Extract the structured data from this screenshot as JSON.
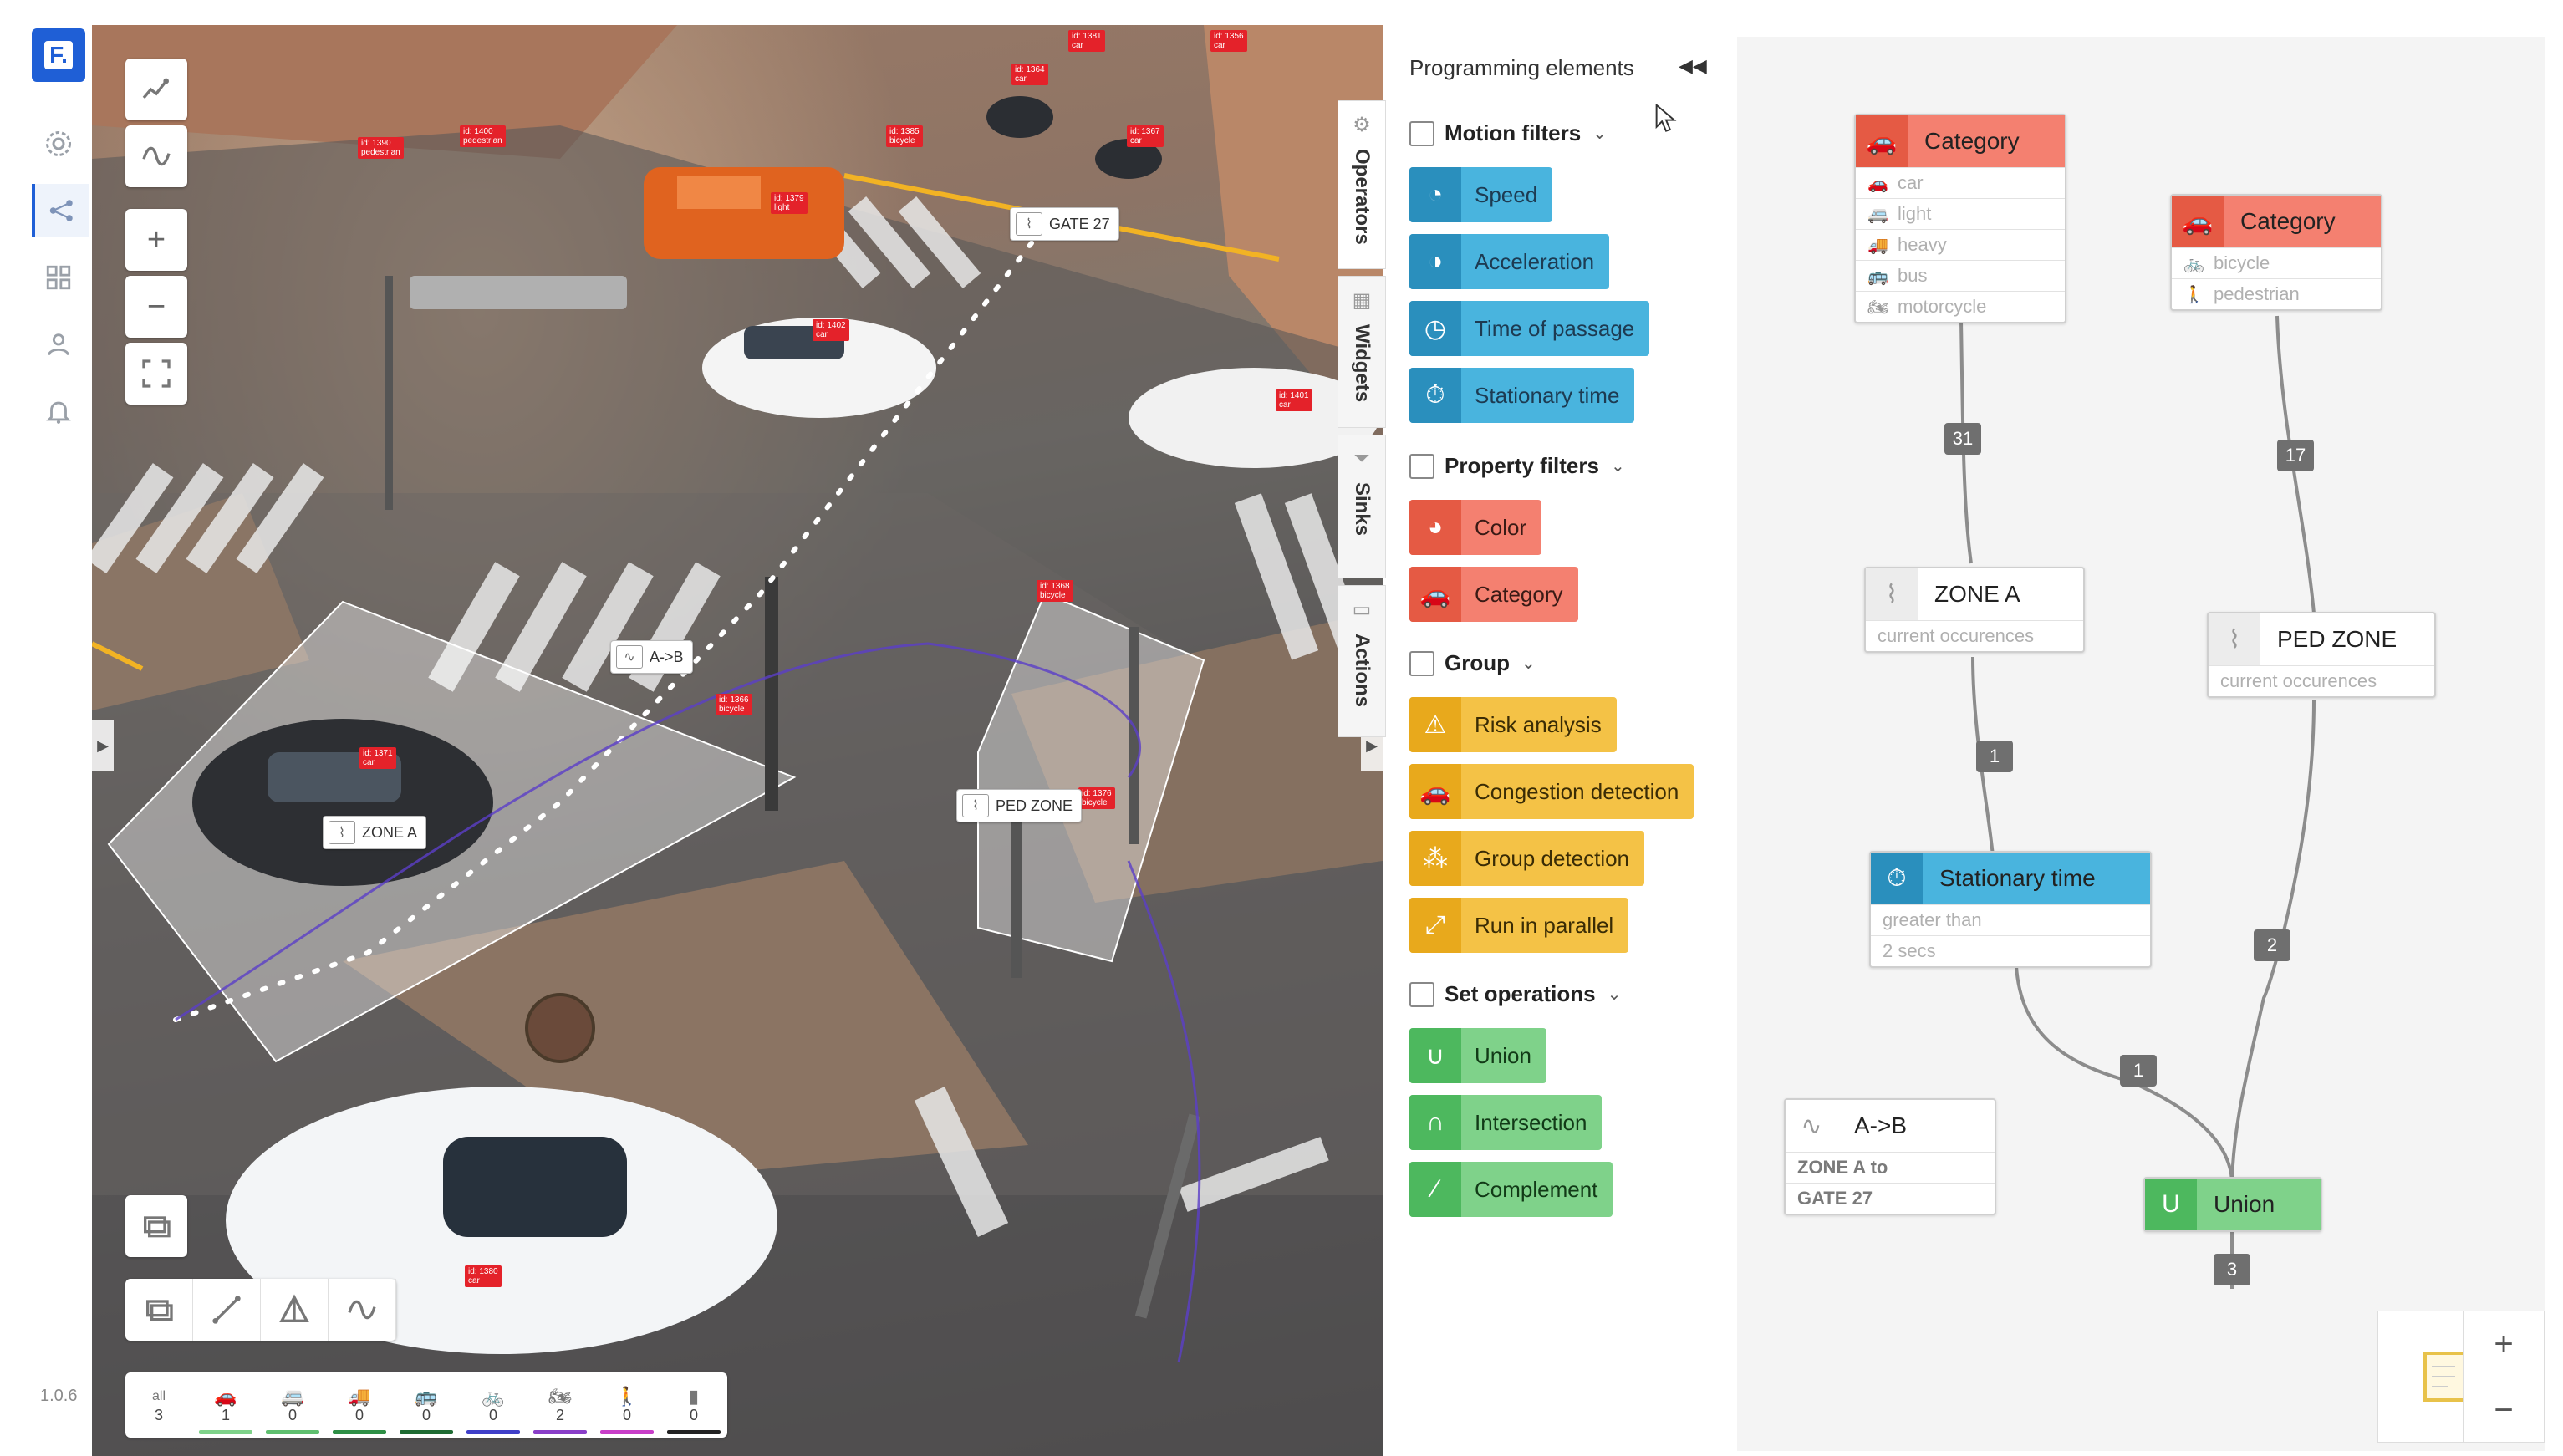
{
  "app": {
    "logo": "F.",
    "version": "1.0.6",
    "rail_icons": [
      "gear-icon",
      "graph-icon",
      "grid-icon",
      "user-icon",
      "bell-icon"
    ]
  },
  "video": {
    "zone_labels": {
      "gate": "GATE 27",
      "ab": "A->B",
      "zone_a": "ZONE A",
      "ped_zone": "PED ZONE"
    },
    "tags": [
      {
        "text": "id: 1390\npedestrian"
      },
      {
        "text": "id: 1400\npedestrian"
      },
      {
        "text": "id: 1385\nbicycle"
      },
      {
        "text": "id: 1379\nlight"
      },
      {
        "text": "id: 1364\ncar"
      },
      {
        "text": "id: 1367\ncar"
      },
      {
        "text": "id: 1402\ncar"
      },
      {
        "text": "id: 1401\ncar"
      },
      {
        "text": "id: 1366\nbicycle"
      },
      {
        "text": "id: 1368\nbicycle"
      },
      {
        "text": "id: 1371\ncar"
      },
      {
        "text": "id: 1376\nbicycle"
      },
      {
        "text": "id: 1380\ncar"
      },
      {
        "text": "id: 1356\ncar"
      },
      {
        "text": "id: 1381\ncar"
      }
    ],
    "counts": [
      {
        "icon": "all",
        "value": "3",
        "color": "#ffffff"
      },
      {
        "icon": "car-icon",
        "value": "1",
        "color": "#7fd28a"
      },
      {
        "icon": "van-icon",
        "value": "0",
        "color": "#5fbf6f"
      },
      {
        "icon": "truck-icon",
        "value": "0",
        "color": "#2e8f46"
      },
      {
        "icon": "bus-icon",
        "value": "0",
        "color": "#1f6b33"
      },
      {
        "icon": "bicycle-icon",
        "value": "0",
        "color": "#3f3fc8"
      },
      {
        "icon": "motorcycle-icon",
        "value": "2",
        "color": "#8a3fc8"
      },
      {
        "icon": "pedestrian-icon",
        "value": "0",
        "color": "#c83fc8"
      },
      {
        "icon": "other-icon",
        "value": "0",
        "color": "#222222"
      }
    ]
  },
  "tabs": [
    "Operators",
    "Widgets",
    "Sinks",
    "Actions"
  ],
  "palette": {
    "title": "Programming elements",
    "groups": [
      {
        "title": "Motion filters",
        "items": [
          "Speed",
          "Acceleration",
          "Time of passage",
          "Stationary time"
        ]
      },
      {
        "title": "Property filters",
        "items": [
          "Color",
          "Category"
        ]
      },
      {
        "title": "Group",
        "items": [
          "Risk analysis",
          "Congestion detection",
          "Group detection",
          "Run in parallel"
        ]
      },
      {
        "title": "Set operations",
        "items": [
          "Union",
          "Intersection",
          "Complement"
        ]
      }
    ]
  },
  "graph": {
    "cat1": {
      "title": "Category",
      "rows": [
        "car",
        "light",
        "heavy",
        "bus",
        "motorcycle"
      ]
    },
    "cat2": {
      "title": "Category",
      "rows": [
        "bicycle",
        "pedestrian"
      ]
    },
    "zone_a": {
      "title": "ZONE A",
      "sub": "current occurences"
    },
    "ped_zone": {
      "title": "PED ZONE",
      "sub": "current occurences"
    },
    "stationary": {
      "title": "Stationary time",
      "rows": [
        "greater than",
        "2 secs"
      ]
    },
    "ab": {
      "title": "A->B",
      "rows": [
        "ZONE A to",
        "GATE 27"
      ]
    },
    "union": {
      "title": "Union",
      "icon": "U"
    },
    "badges": [
      "31",
      "17",
      "1",
      "2",
      "1",
      "3"
    ]
  },
  "colors": {
    "accent": "#1f5fd6",
    "motion": "#49b4de",
    "property": "#f48070",
    "group": "#f4c246",
    "set": "#7fd28a"
  }
}
